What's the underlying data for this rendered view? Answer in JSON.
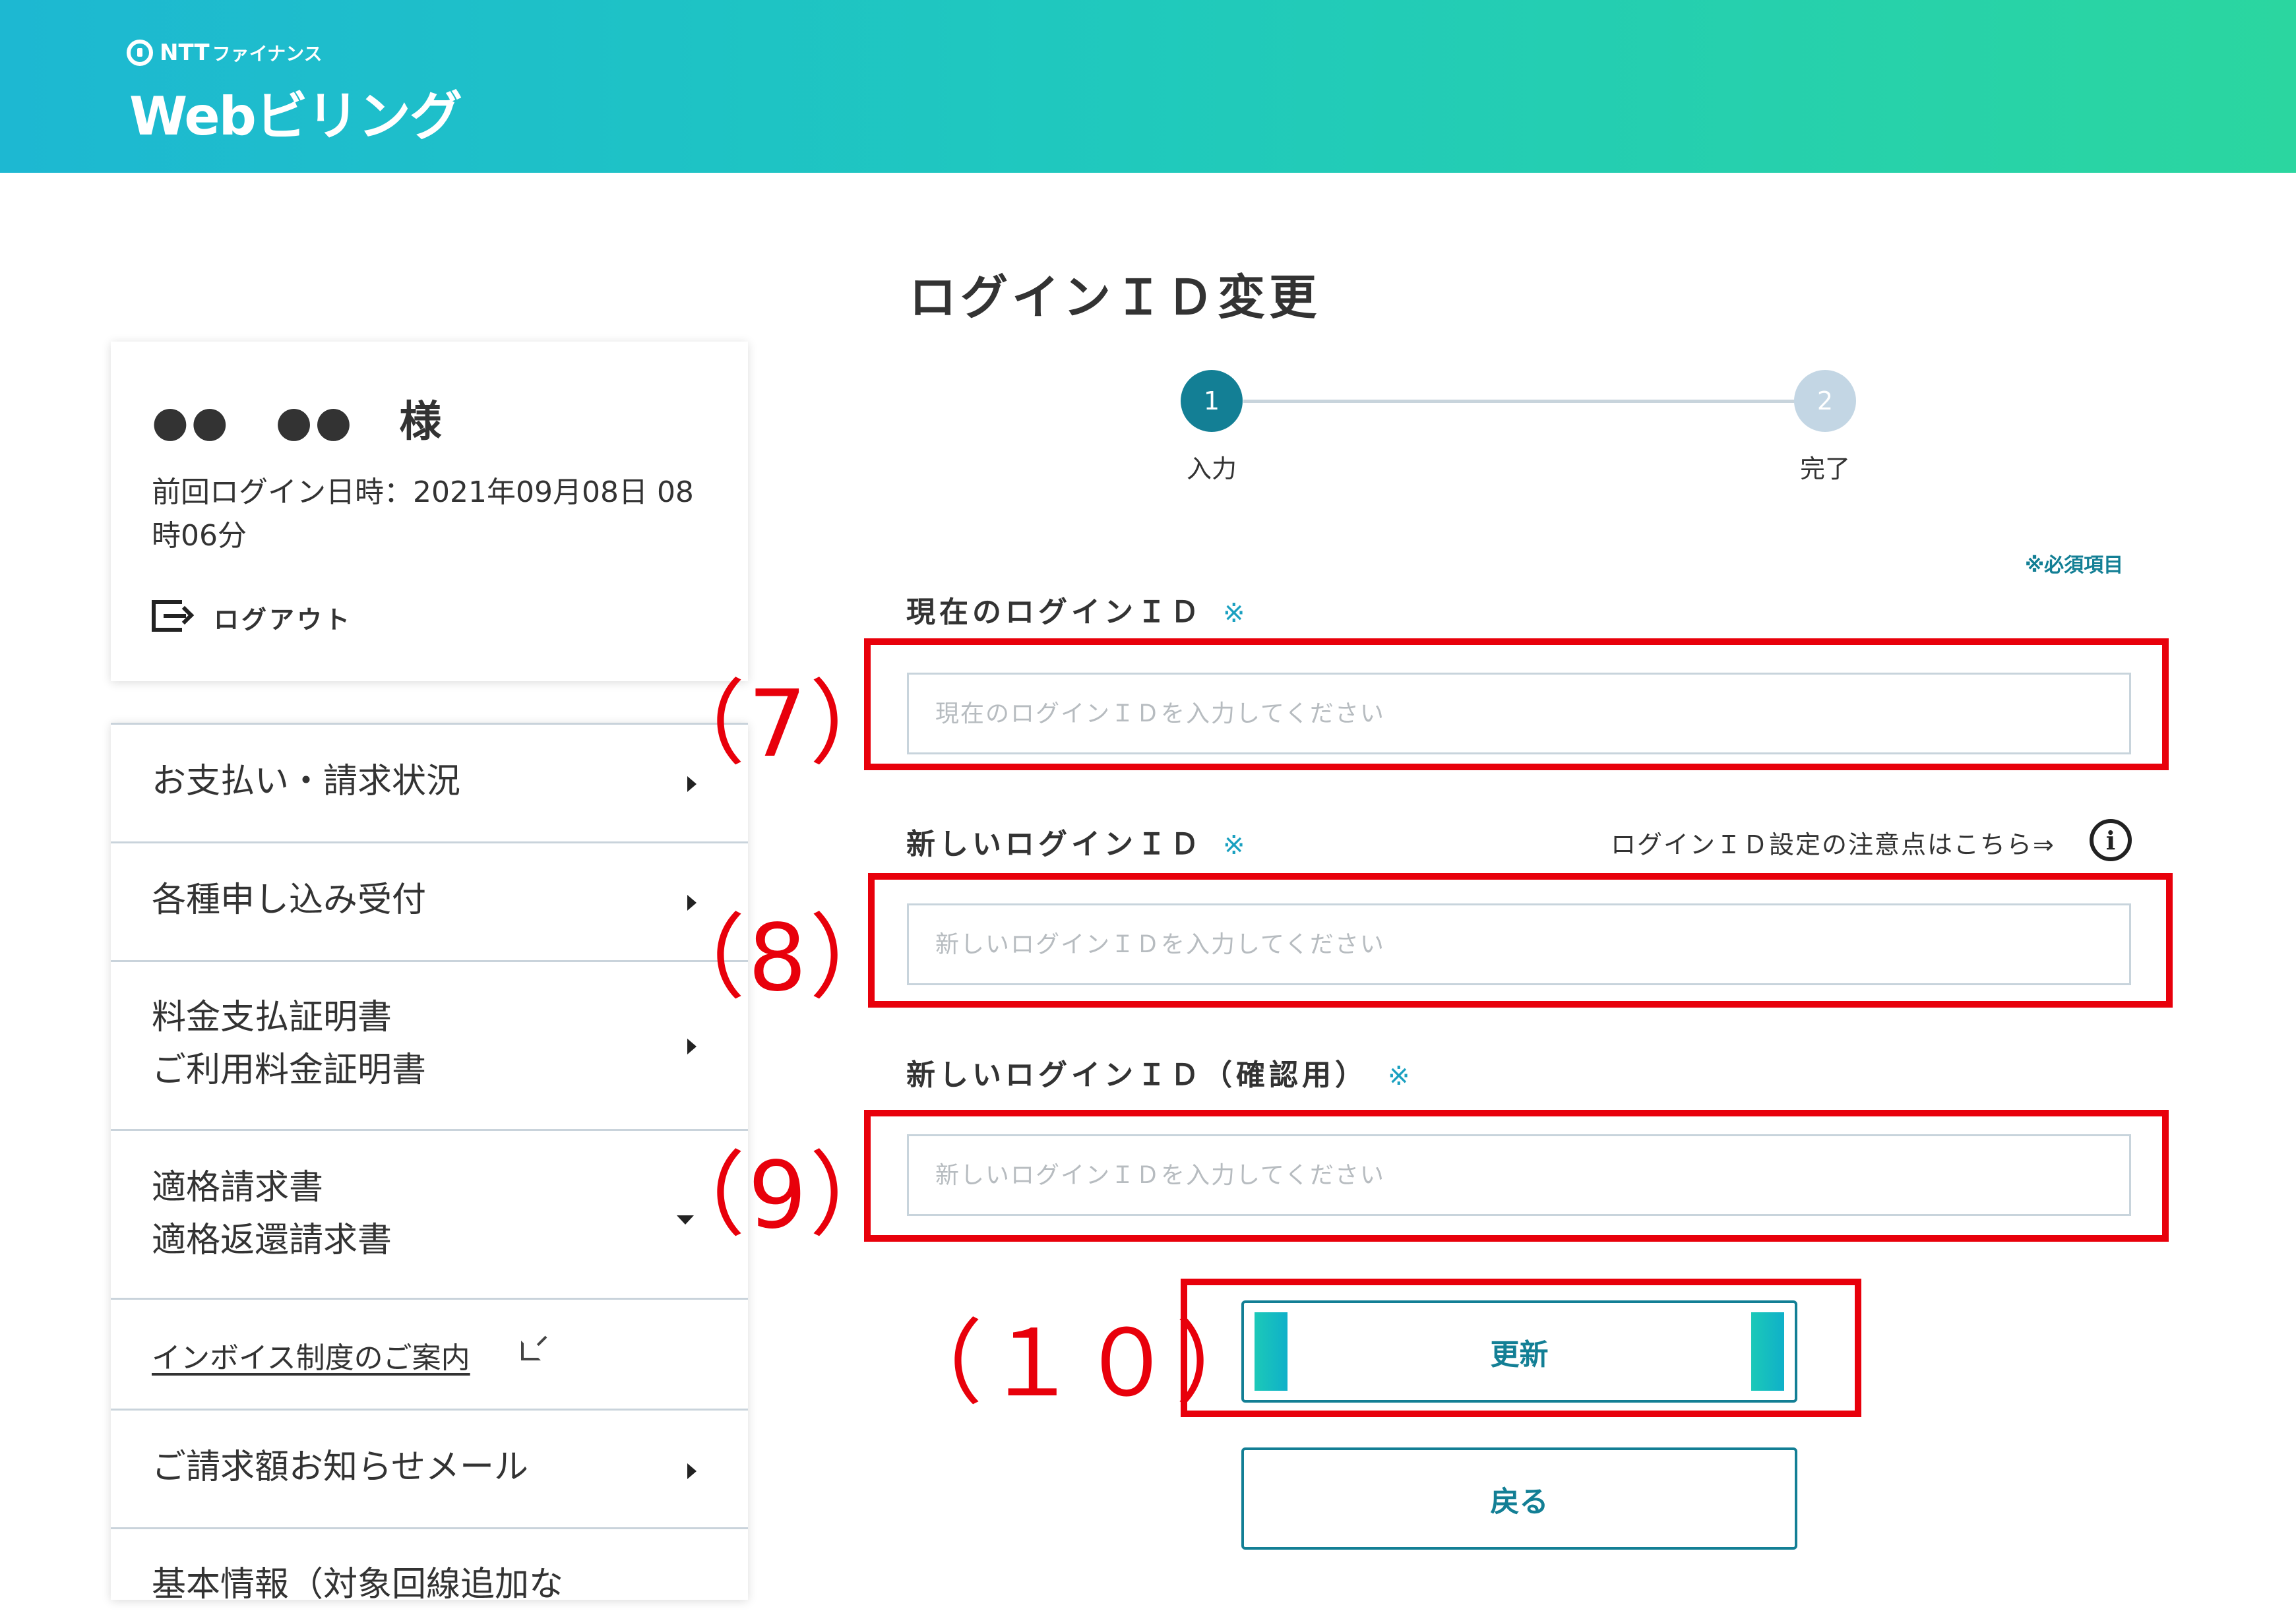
{
  "header": {
    "company": "NTT",
    "company_sub": "ファイナンス",
    "service_name": "Webビリング",
    "brand_color": "#1db8d2"
  },
  "sidebar": {
    "user_name": "●●　●●　様",
    "last_login_label": "前回ログイン日時：2021年09月08日 08時06分",
    "logout_label": "ログアウト",
    "menu_items": [
      {
        "label": "お支払い・請求状況",
        "icon": "chevron-right-icon"
      },
      {
        "label": "各種申し込み受付",
        "icon": "chevron-right-icon"
      },
      {
        "label": "料金支払証明書\nご利用料金証明書",
        "icon": "chevron-right-icon"
      },
      {
        "label": "適格請求書\n適格返還請求書",
        "icon": "chevron-down-icon"
      },
      {
        "label": "インボイス制度のご案内",
        "icon": "external-link-icon"
      },
      {
        "label": "ご請求額お知らせメール",
        "icon": "chevron-right-icon"
      },
      {
        "label": "基本情報（対象回線追加な",
        "icon": "chevron-right-icon"
      }
    ]
  },
  "main": {
    "title": "ログインＩＤ変更",
    "steps": [
      {
        "number": "1",
        "label": "入力",
        "active": true
      },
      {
        "number": "2",
        "label": "完了",
        "active": false
      }
    ],
    "required_note": "※必須項目",
    "required_mark": "※",
    "fields": [
      {
        "label": "現在のログインＩＤ",
        "placeholder": "現在のログインＩＤを入力してください",
        "value": ""
      },
      {
        "label": "新しいログインＩＤ",
        "placeholder": "新しいログインＩＤを入力してください",
        "value": ""
      },
      {
        "label": "新しいログインＩＤ（確認用）",
        "placeholder": "新しいログインＩＤを入力してください",
        "value": ""
      }
    ],
    "hint_link": "ログインＩＤ設定の注意点はこちら⇒",
    "info_icon_glyph": "i",
    "update_button": "更新",
    "back_button": "戻る"
  },
  "annotations": {
    "a7": "（7）",
    "a8": "（8）",
    "a9": "（9）",
    "a10": "（１０）",
    "color": "#e8000b"
  }
}
